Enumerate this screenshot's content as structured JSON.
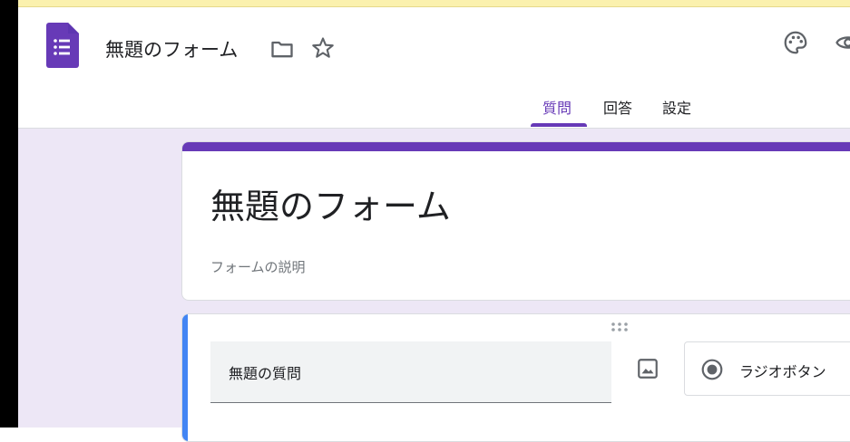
{
  "header": {
    "form_title": "無題のフォーム",
    "logo_icon": "google-forms-icon",
    "icons": [
      "folder-icon",
      "star-icon",
      "palette-icon",
      "eye-icon"
    ],
    "tabs": [
      {
        "label": "質問",
        "active": true
      },
      {
        "label": "回答",
        "active": false
      },
      {
        "label": "設定",
        "active": false
      }
    ]
  },
  "title_card": {
    "title": "無題のフォーム",
    "description_placeholder": "フォームの説明"
  },
  "question_card": {
    "question_text": "無題の質問",
    "type_label": "ラジオボタン",
    "icons": [
      "drag-handle-icon",
      "image-icon",
      "radio-button-icon"
    ]
  },
  "colors": {
    "accent": "#673ab7",
    "canvas_bg": "#ede7f6",
    "active_question": "#4285f4",
    "banner": "#fbf1ae"
  }
}
